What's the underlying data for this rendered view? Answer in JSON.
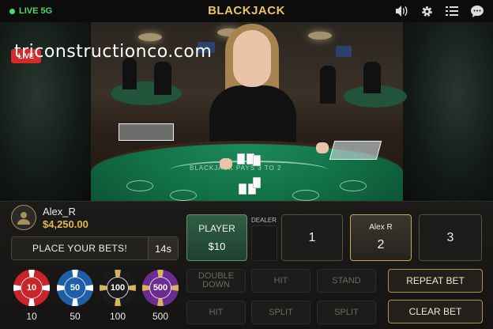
{
  "topbar": {
    "live_label": "LIVE 5G",
    "title": "BLACKJACK",
    "icons": [
      "volume-icon",
      "settings-icon",
      "menu-icon",
      "chat-icon"
    ]
  },
  "video": {
    "watermark": "triconstructionco.com",
    "live_badge": "LIVE",
    "felt_text": "BLACKJACK PAYS 3 TO 2"
  },
  "user": {
    "name": "Alex_R",
    "balance": "$4,250.00"
  },
  "status": {
    "message": "PLACE YOUR BETS!",
    "timer": "14s"
  },
  "chips": [
    {
      "value": "10",
      "label": "10",
      "color": "#c8262b"
    },
    {
      "value": "50",
      "label": "50",
      "color": "#1f5fa8"
    },
    {
      "value": "100",
      "label": "100",
      "color": "#1a1a1a"
    },
    {
      "value": "500",
      "label": "500",
      "color": "#6a2c91"
    }
  ],
  "betting": {
    "player_label": "PLAYER",
    "player_amount": "$10",
    "dealer_label": "DEALER",
    "seats": [
      {
        "top": "",
        "label": "1"
      },
      {
        "top": "Alex R",
        "label": "2"
      },
      {
        "top": "",
        "label": "3"
      }
    ]
  },
  "actions": {
    "double_down": "DOUBLE DOWN",
    "hit_1": "HIT",
    "stand": "STAND",
    "hit_2": "HIT",
    "split_1": "SPLIT",
    "split_2": "SPLIT",
    "repeat_bet": "REPEAT BET",
    "clear_bet": "CLEAR BET"
  },
  "colors": {
    "gold": "#e3b84c",
    "live_green": "#4cd964",
    "felt_green": "#127046"
  }
}
